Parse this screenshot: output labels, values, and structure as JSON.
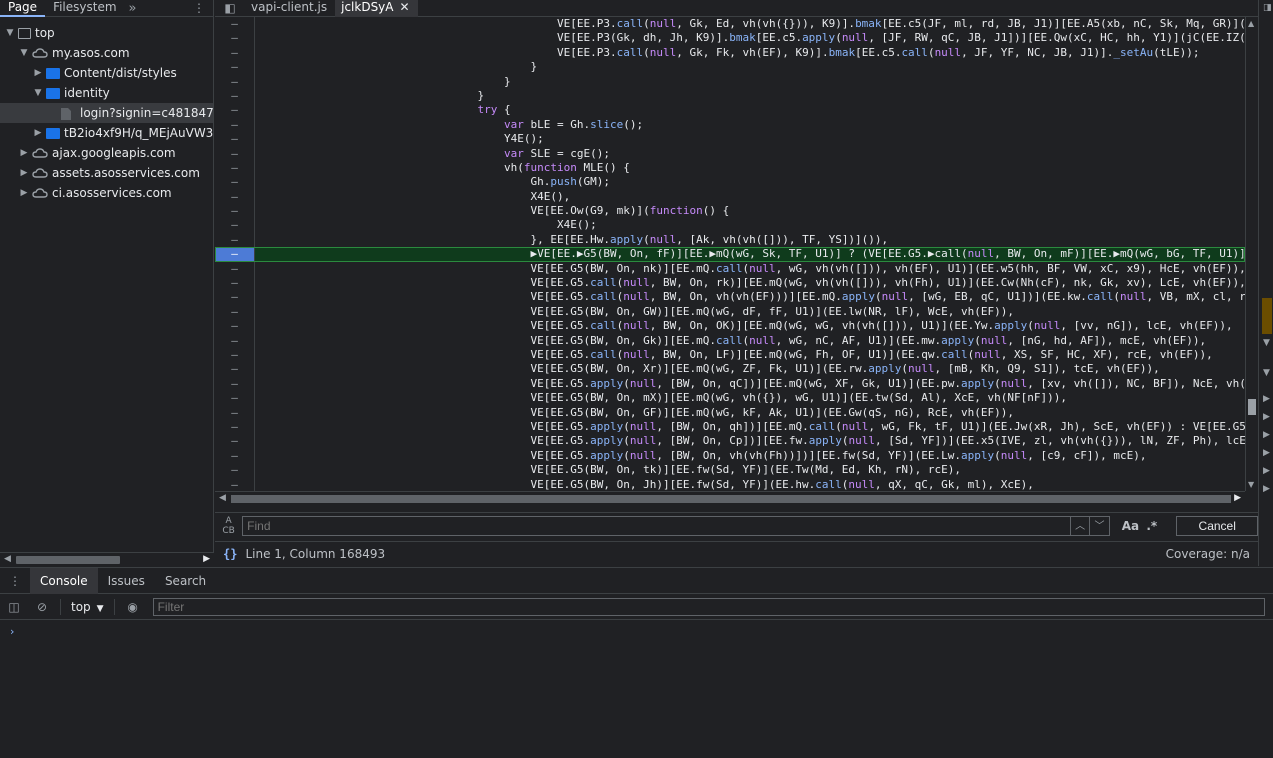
{
  "navigator": {
    "tabs": [
      "Page",
      "Filesystem"
    ],
    "more": "»",
    "tree": [
      {
        "label": "top",
        "icon": "frame-icon",
        "indent": 0,
        "expanded": true
      },
      {
        "label": "my.asos.com",
        "icon": "cloud-icon",
        "indent": 1,
        "expanded": true
      },
      {
        "label": "Content/dist/styles",
        "icon": "folder-icon",
        "indent": 2,
        "expanded": false
      },
      {
        "label": "identity",
        "icon": "folder-icon",
        "indent": 2,
        "expanded": true
      },
      {
        "label": "login?signin=c481847f3ae",
        "icon": "file-icon",
        "indent": 3,
        "selected": true
      },
      {
        "label": "tB2io4xf9H/q_MEjAuVW3/Ea",
        "icon": "folder-icon",
        "indent": 2,
        "expanded": false
      },
      {
        "label": "ajax.googleapis.com",
        "icon": "cloud-icon",
        "indent": 1,
        "expanded": false
      },
      {
        "label": "assets.asosservices.com",
        "icon": "cloud-icon",
        "indent": 1,
        "expanded": false
      },
      {
        "label": "ci.asosservices.com",
        "icon": "cloud-icon",
        "indent": 1,
        "expanded": false
      }
    ]
  },
  "editor": {
    "tabs": [
      {
        "label": "vapi-client.js",
        "active": false
      },
      {
        "label": "jclkDSyA",
        "active": true,
        "close": "✕"
      }
    ],
    "lines": [
      "                                             VE[EE.P3.call(null, Gk, Ed, vh(vh({})), K9)].bmak[EE.c5(JF, ml, rd, JB, J1)][EE.A5(xb, nC, Sk, Mq, GR)](jC(EE.IZ",
      "                                             VE[EE.P3(Gk, dh, Jh, K9)].bmak[EE.c5.apply(null, [JF, RW, qC, JB, J1])][EE.Qw(xC, HC, hh, Y1)](jC(EE.IZ(GT, m",
      "                                             VE[EE.P3.call(null, Gk, Fk, vh(EF), K9)].bmak[EE.c5.call(null, JF, YF, NC, JB, J1)]._setAu(tLE));",
      "                                         }",
      "                                     }",
      "                                 }",
      "                                 try {",
      "                                     var bLE = Gh.slice();",
      "                                     Y4E();",
      "                                     var SLE = cgE();",
      "                                     vh(function MLE() {",
      "                                         Gh.push(GM);",
      "                                         X4E(),",
      "                                         VE[EE.Ow(G9, mk)](function() {",
      "                                             X4E();",
      "                                         }, EE[EE.Hw.apply(null, [Ak, vh(vh([])), TF, YS])]()),",
      "                                         ▶VE[EE.▶G5(BW, On, fF)][EE.▶mQ(wG, Sk, TF, U1)] ? (VE[EE.G5.▶call(null, BW, On, mF)][EE.▶mQ(wG, bG, TF, U1)]▶(E",
      "                                         VE[EE.G5(BW, On, nk)][EE.mQ.call(null, wG, vh(vh([])), vh(EF), U1)](EE.w5(hh, BF, VW, xC, x9), HcE, vh(EF)),",
      "                                         VE[EE.G5.call(null, BW, On, rk)][EE.mQ(wG, vh(vh([])), vh(Fh), U1)](EE.Cw(Nh(cF), nk, Gk, xv), LcE, vh(EF)),",
      "                                         VE[EE.G5.call(null, BW, On, vh(vh(EF)))][EE.mQ.apply(null, [wG, EB, qC, U1])](EE.kw.call(null, VB, mX, cl, r8), h",
      "                                         VE[EE.G5(BW, On, GW)][EE.mQ(wG, dF, fF, U1)](EE.lw(NR, lF), WcE, vh(EF)),",
      "                                         VE[EE.G5.call(null, BW, On, OK)][EE.mQ(wG, wG, vh(vh([])), U1)](EE.Yw.apply(null, [vv, nG]), lcE, vh(EF)),",
      "                                         VE[EE.G5(BW, On, Gk)][EE.mQ.call(null, wG, nC, AF, U1)](EE.mw.apply(null, [nG, hd, AF]), mcE, vh(EF)),",
      "                                         VE[EE.G5.call(null, BW, On, LF)][EE.mQ(wG, Fh, OF, U1)](EE.qw.call(null, XS, SF, HC, XF), rcE, vh(EF)),",
      "                                         VE[EE.G5(BW, On, Xr)][EE.mQ(wG, ZF, Fk, U1)](EE.rw.apply(null, [mB, Kh, Q9, S1]), tcE, vh(EF)),",
      "                                         VE[EE.G5.apply(null, [BW, On, qC])][EE.mQ(wG, XF, Gk, U1)](EE.pw.apply(null, [xv, vh([]), NC, BF]), NcE, vh(EF)),",
      "                                         VE[EE.G5(BW, On, mX)][EE.mQ(wG, vh({}), wG, U1)](EE.tw(Sd, Al), XcE, vh(NF[nF])),",
      "                                         VE[EE.G5(BW, On, GF)][EE.mQ(wG, kF, Ak, U1)](EE.Gw(qS, nG), RcE, vh(EF)),",
      "                                         VE[EE.G5.apply(null, [BW, On, qh])][EE.mQ.call(null, wG, Fk, tF, U1)](EE.Jw(xR, Jh), ScE, vh(EF)) : VE[EE.G5.app",
      "                                         VE[EE.G5.apply(null, [BW, On, Cp])][EE.fw.apply(null, [Sd, YF])](EE.x5(IVE, zl, vh(vh({})), lN, ZF, Ph), lcE),",
      "                                         VE[EE.G5.apply(null, [BW, On, vh(vh(Fh))])][EE.fw(Sd, YF)](EE.Lw.apply(null, [c9, cF]), mcE),",
      "                                         VE[EE.G5(BW, On, tk)][EE.fw(Sd, YF)](EE.Tw(Md, Ed, Kh, rN), rcE),",
      "                                         VE[EE.G5(BW, On, Jh)][EE.fw(Sd, YF)](EE.hw.call(null, qX, qC, Gk, ml), XcE),"
    ],
    "gutter_marker": "–"
  },
  "find": {
    "placeholder": "Find",
    "case_label": "Aa",
    "regex_label": ".*",
    "cancel_label": "Cancel"
  },
  "status": {
    "pretty_print": "{}",
    "position": "Line 1, Column 168493",
    "coverage": "Coverage: n/a"
  },
  "drawer": {
    "tabs": [
      "Console",
      "Issues",
      "Search"
    ],
    "context": "top",
    "filter_placeholder": "Filter",
    "prompt": "›"
  }
}
